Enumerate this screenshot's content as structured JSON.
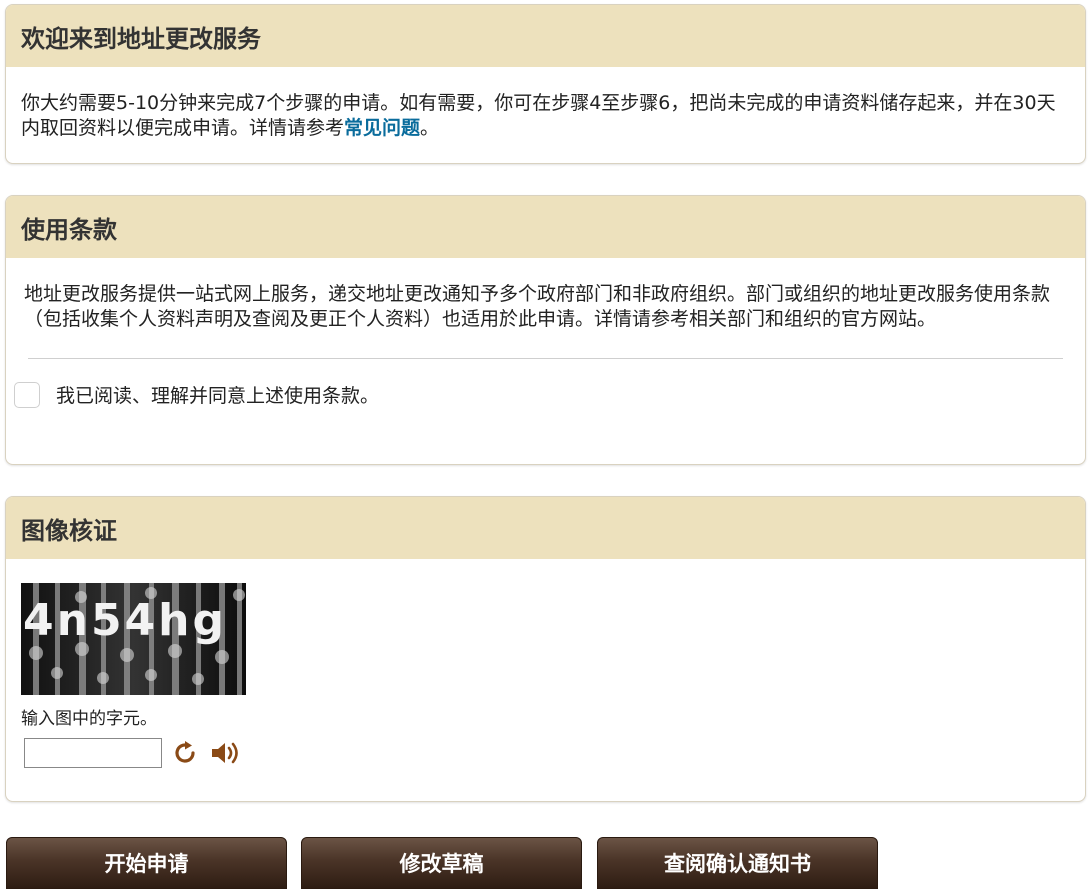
{
  "welcome": {
    "title": "欢迎来到地址更改服务",
    "text_before_link": "你大约需要5-10分钟来完成7个步骤的申请。如有需要，你可在步骤4至步骤6，把尚未完成的申请资料储存起来，并在30天内取回资料以便完成申请。详情请参考",
    "link": "常见问题",
    "text_after_link": "。"
  },
  "terms": {
    "title": "使用条款",
    "text": "地址更改服务提供一站式网上服务，递交地址更改通知予多个政府部门和非政府组织。部门或组织的地址更改服务使用条款（包括收集个人资料声明及查阅及更正个人资料）也适用於此申请。详情请参考相关部门和组织的官方网站。",
    "agree_label": "我已阅读、理解并同意上述使用条款。",
    "agree_checked": false
  },
  "verification": {
    "title": "图像核证",
    "captcha_text": "4n54hg",
    "hint": "输入图中的字元。",
    "input_value": "",
    "refresh_icon": "refresh-icon",
    "audio_icon": "speaker-icon",
    "icon_color": "#8a4a16"
  },
  "actions": {
    "start": "开始申请",
    "edit_draft": "修改草稿",
    "view_confirmation": "查阅确认通知书"
  }
}
